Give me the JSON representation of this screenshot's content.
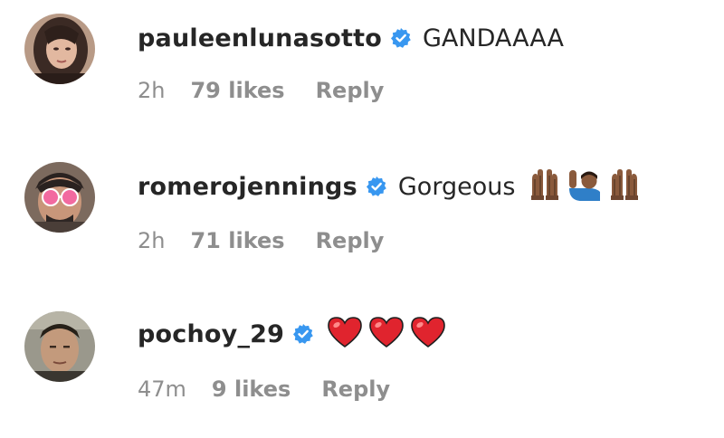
{
  "comments": [
    {
      "username": "pauleenlunasotto",
      "text": "GANDAAAA",
      "emojis": [],
      "time": "2h",
      "likes": "79 likes",
      "reply": "Reply"
    },
    {
      "username": "romerojennings",
      "text": "Gorgeous",
      "emojis": [
        "raising-hands-icon",
        "raising-hand-person-icon",
        "raising-hands-icon"
      ],
      "time": "2h",
      "likes": "71 likes",
      "reply": "Reply"
    },
    {
      "username": "pochoy_29",
      "text": "",
      "emojis": [
        "red-heart-icon",
        "red-heart-icon",
        "red-heart-icon"
      ],
      "time": "47m",
      "likes": "9 likes",
      "reply": "Reply"
    }
  ],
  "colors": {
    "username": "#262626",
    "meta": "#8e8e8e",
    "verified": "#3897f0",
    "heart": "#e0242e"
  }
}
